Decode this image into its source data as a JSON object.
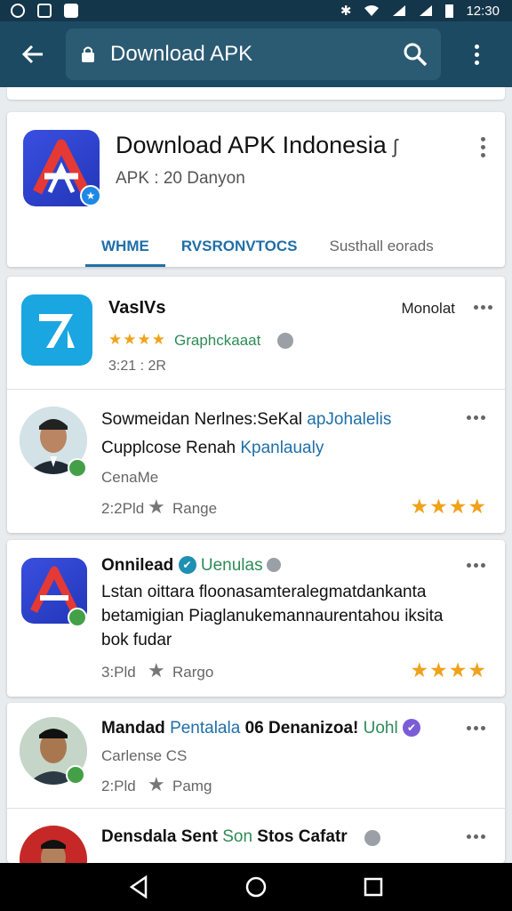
{
  "status_bar": {
    "time": "12:30"
  },
  "app_bar": {
    "search_text": "Download APK"
  },
  "header": {
    "title": "Download APK Indonesia",
    "title_suffix": "ʃ",
    "subtitle": "APK : 20 Danyon",
    "tabs": [
      {
        "label": "WHME",
        "active": true
      },
      {
        "label": "RVSRONVTOCS",
        "active": false
      },
      {
        "label": "Susthall eorads",
        "active": false
      }
    ]
  },
  "feed": [
    {
      "type": "app",
      "name": "VasIVs",
      "badge": "Monolat",
      "rating_stars": "★★★★",
      "category": "Graphckaaat",
      "time": "3:21 : 2R"
    },
    {
      "type": "post",
      "line1_a": "Sowmeidan Nerlnes:SeKal ",
      "line1_b": "apJohalelis",
      "line2_a": "Cupplcose Renah ",
      "line2_b": "Kpanlaualy",
      "author": "CenaMe",
      "time": "2:2Pld",
      "action": "Range",
      "rating": "★★★★"
    },
    {
      "type": "post",
      "title_a": "Onnilead ",
      "title_b": "Uenulas",
      "body1": "Lstan oittara floonasamteralegmatdankanta",
      "body2": "betamigian Piaglanukemannaurentahou iksita",
      "body3": "bok fudar",
      "time": "3:Pld",
      "action": "Rargo",
      "rating": "★★★★"
    },
    {
      "type": "post",
      "title_a": "Mandad ",
      "title_b": "Pentalala",
      "title_c": " 06 Denanizoa! ",
      "title_d": "Uohl",
      "author": "Carlense CS",
      "time": "2:Pld",
      "action": "Pamg"
    },
    {
      "type": "post",
      "title_a": "Densdala Sent ",
      "title_b": "Son",
      "title_c": " Stos Cafatr"
    }
  ],
  "colors": {
    "app_bar": "#1d4a63",
    "accent": "#1f6fa8",
    "star": "#f0a21b",
    "online": "#43a047"
  }
}
